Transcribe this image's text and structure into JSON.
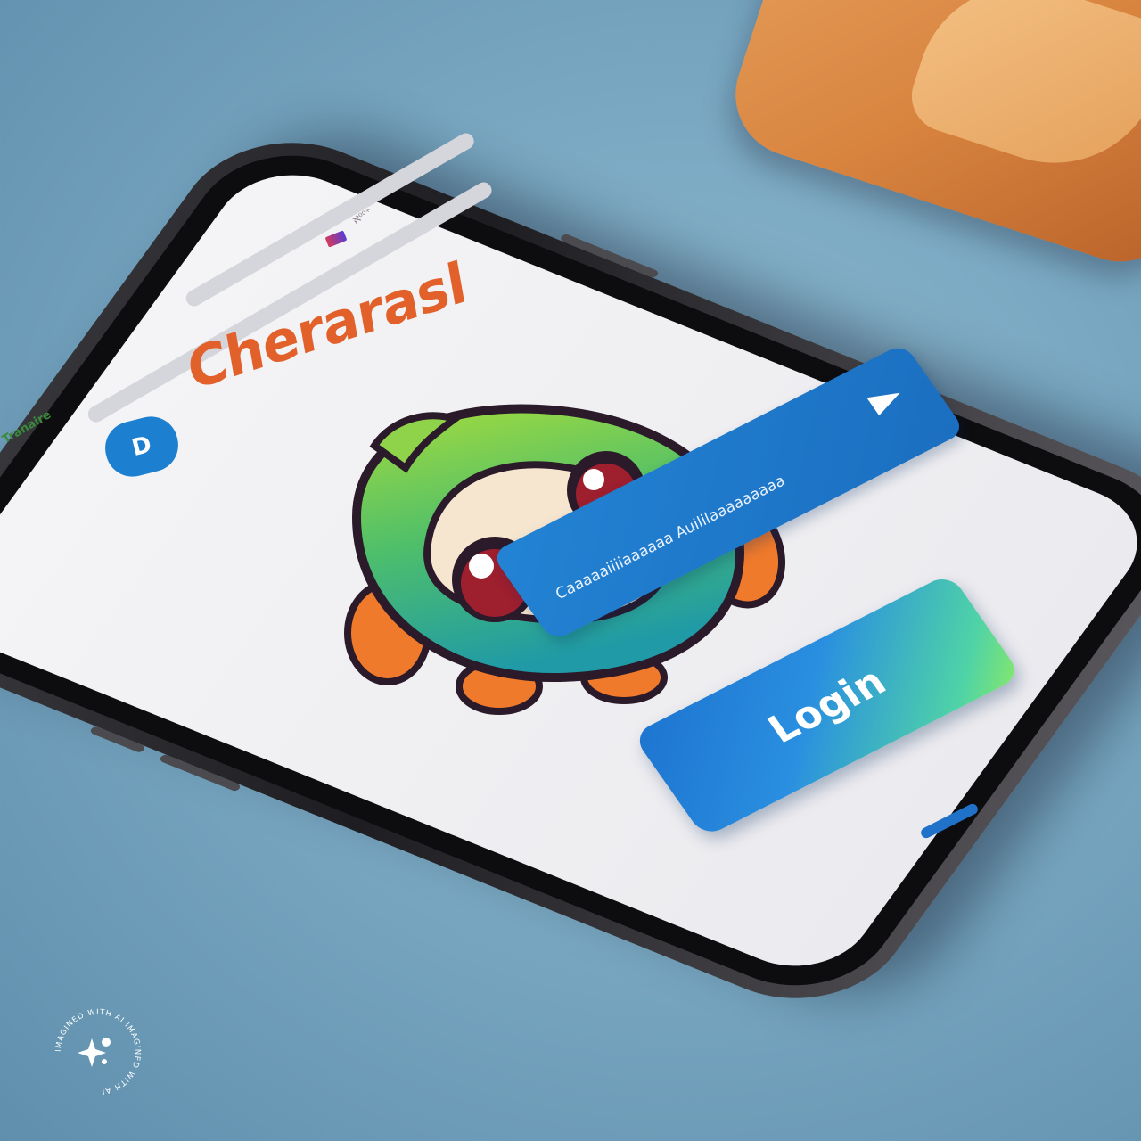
{
  "app": {
    "brand_name": "Cherarasl",
    "logo_glyph": "D"
  },
  "status": {
    "carrier_text": "ℵ⁰⁰⁺"
  },
  "side_label": "Tranaire",
  "input": {
    "value": "Caaaaaiiiiaaaaaa Auililaaaaaaaaa"
  },
  "login": {
    "label": "Login"
  },
  "watermark": {
    "text": "IMAGINED WITH AI IMAGINED WITH AI"
  },
  "colors": {
    "brand": "#e2612b",
    "accent": "#1d7fd0",
    "mascot_top": "#8fd34a",
    "mascot_bottom": "#2aa6a0",
    "mascot_fins": "#f07a2c",
    "background": "#7aa8c2"
  },
  "icons": {
    "logo": "logo-badge-icon",
    "send": "send-arrow-icon",
    "watermark": "sparkle-icon"
  }
}
